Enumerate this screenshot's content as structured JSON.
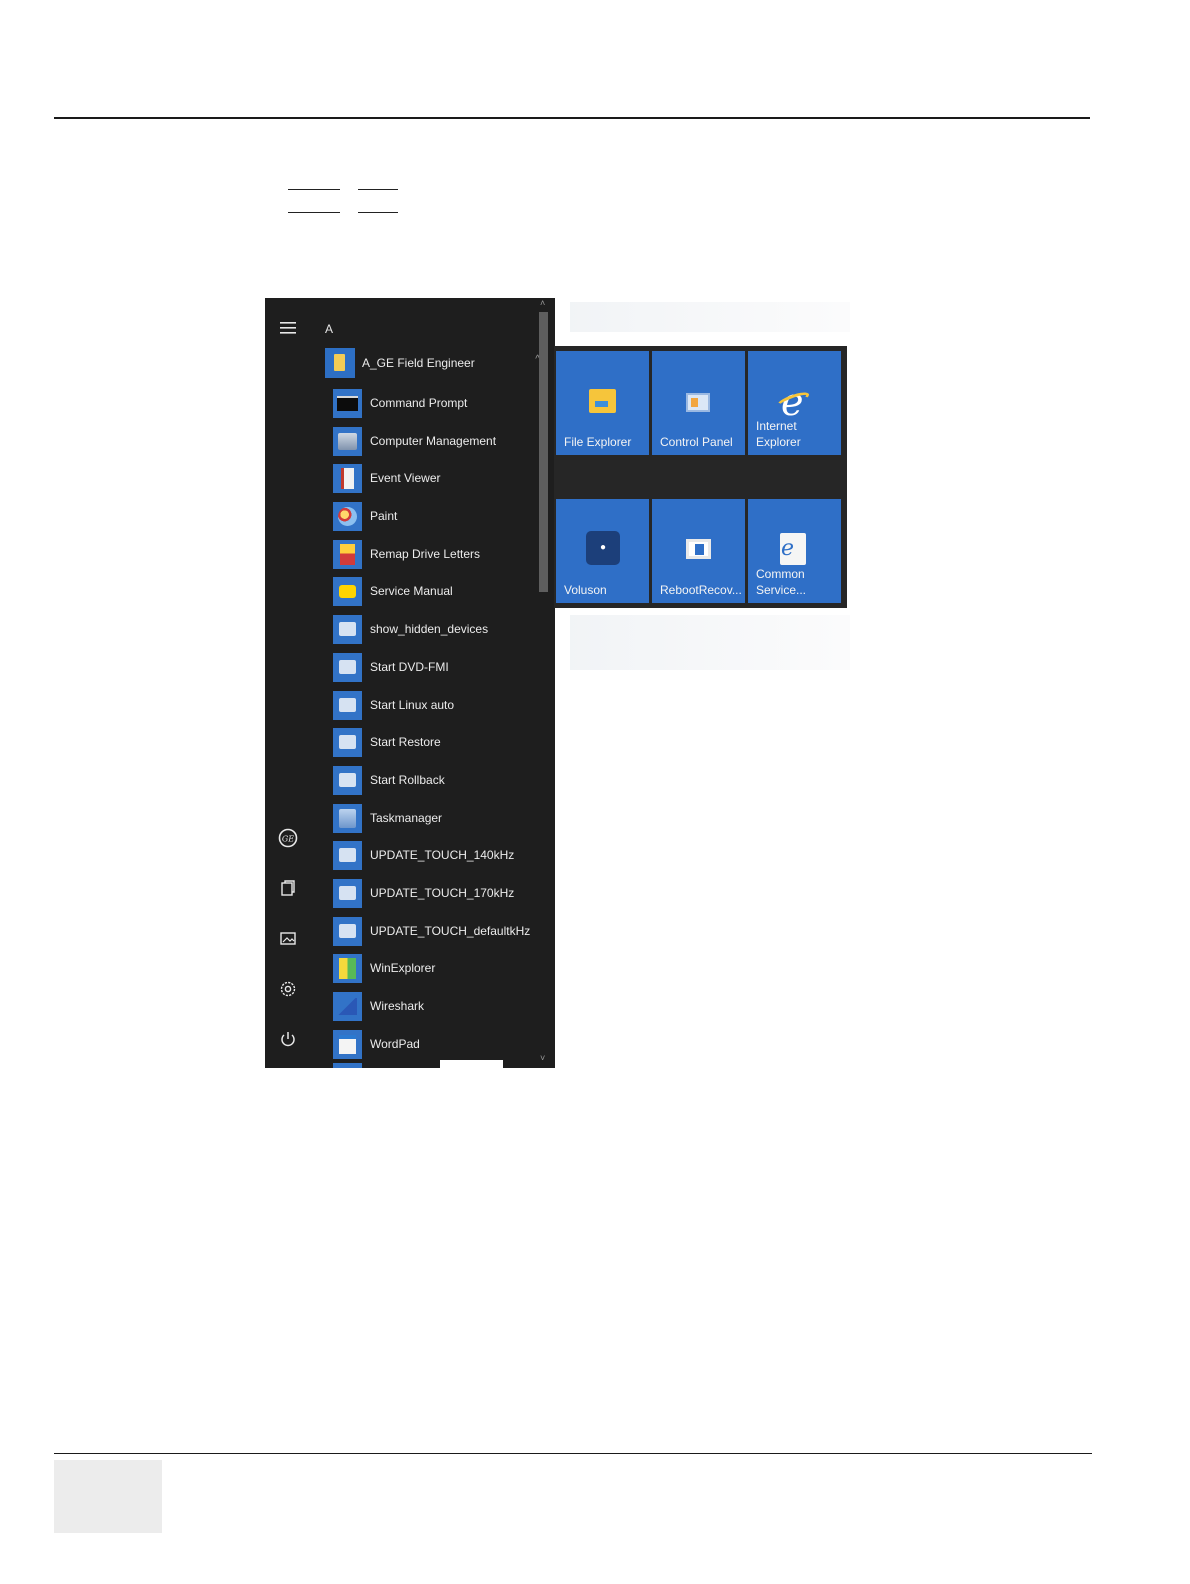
{
  "document": {
    "header_rule": true,
    "footer_rule": true
  },
  "start_menu": {
    "rail": {
      "menu_icon": "hamburger-menu-icon",
      "bottom_icons": [
        "ge-logo-icon",
        "document-icon",
        "pictures-icon",
        "settings-icon",
        "power-icon"
      ]
    },
    "section_letter": "A",
    "folder": {
      "label": "A_GE Field Engineer",
      "expanded_glyph": "^"
    },
    "items": [
      {
        "label": "Command Prompt",
        "icon": "command-prompt-icon"
      },
      {
        "label": "Computer Management",
        "icon": "computer-management-icon"
      },
      {
        "label": "Event Viewer",
        "icon": "event-viewer-icon"
      },
      {
        "label": "Paint",
        "icon": "paint-icon"
      },
      {
        "label": "Remap Drive Letters",
        "icon": "remap-drive-icon"
      },
      {
        "label": "Service Manual",
        "icon": "service-manual-icon"
      },
      {
        "label": "show_hidden_devices",
        "icon": "shortcut-icon"
      },
      {
        "label": "Start DVD-FMI",
        "icon": "shortcut-icon"
      },
      {
        "label": "Start Linux auto",
        "icon": "shortcut-icon"
      },
      {
        "label": "Start Restore",
        "icon": "shortcut-icon"
      },
      {
        "label": "Start Rollback",
        "icon": "shortcut-icon"
      },
      {
        "label": "Taskmanager",
        "icon": "task-manager-icon"
      },
      {
        "label": "UPDATE_TOUCH_140kHz",
        "icon": "shortcut-icon"
      },
      {
        "label": "UPDATE_TOUCH_170kHz",
        "icon": "shortcut-icon"
      },
      {
        "label": "UPDATE_TOUCH_defaultkHz",
        "icon": "shortcut-icon"
      },
      {
        "label": "WinExplorer",
        "icon": "winexplorer-icon"
      },
      {
        "label": "Wireshark",
        "icon": "wireshark-icon"
      },
      {
        "label": "WordPad",
        "icon": "wordpad-icon"
      }
    ]
  },
  "tiles": [
    {
      "label": "File Explorer",
      "icon": "file-explorer-icon"
    },
    {
      "label": "Control Panel",
      "icon": "control-panel-icon"
    },
    {
      "label_line1": "Internet",
      "label_line2": "Explorer",
      "icon": "internet-explorer-icon"
    },
    {
      "label": "Voluson",
      "icon": "voluson-icon"
    },
    {
      "label": "RebootRecov...",
      "icon": "reboot-recovery-icon"
    },
    {
      "label_line1": "Common",
      "label_line2": "Service...",
      "icon": "common-service-icon"
    }
  ],
  "colors": {
    "menu_background": "#1e1e1e",
    "tile_blue": "#2f6fc7",
    "icon_blue": "#3273c7",
    "text": "#ececec"
  }
}
